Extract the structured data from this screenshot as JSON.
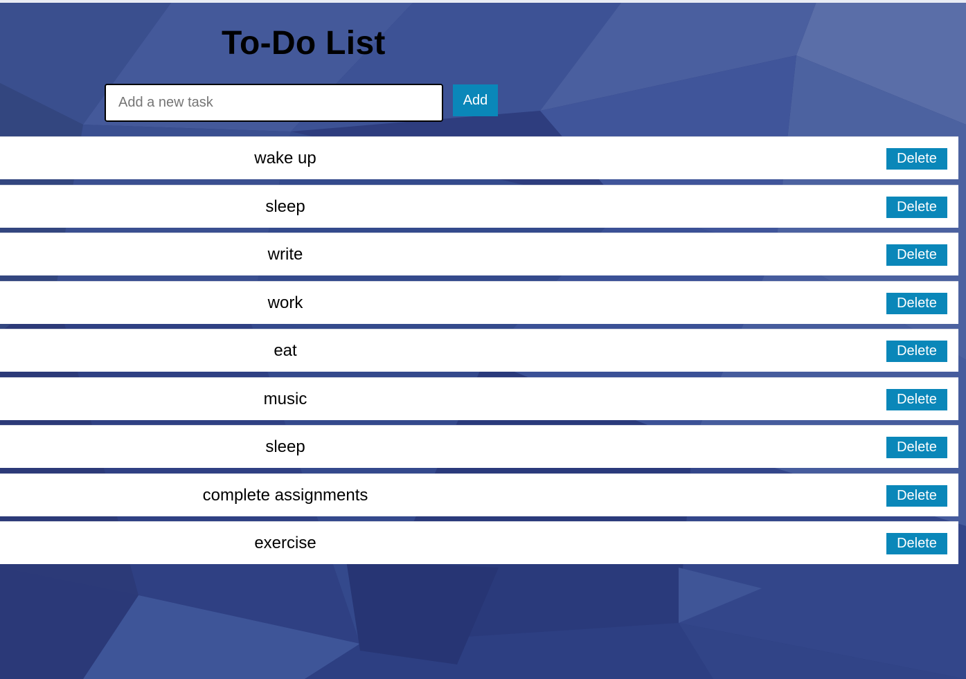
{
  "app": {
    "title": "To-Do List"
  },
  "form": {
    "input_value": "",
    "input_placeholder": "Add a new task",
    "add_label": "Add"
  },
  "tasks": [
    {
      "text": "wake up",
      "delete_label": "Delete"
    },
    {
      "text": "sleep",
      "delete_label": "Delete"
    },
    {
      "text": "write",
      "delete_label": "Delete"
    },
    {
      "text": "work",
      "delete_label": "Delete"
    },
    {
      "text": "eat",
      "delete_label": "Delete"
    },
    {
      "text": "music",
      "delete_label": "Delete"
    },
    {
      "text": "sleep",
      "delete_label": "Delete"
    },
    {
      "text": "complete assignments",
      "delete_label": "Delete"
    },
    {
      "text": "exercise",
      "delete_label": "Delete"
    }
  ],
  "colors": {
    "background": "#2f3f80",
    "button": "#0a87b9",
    "button_text": "#ffffff",
    "row_background": "#ffffff"
  }
}
